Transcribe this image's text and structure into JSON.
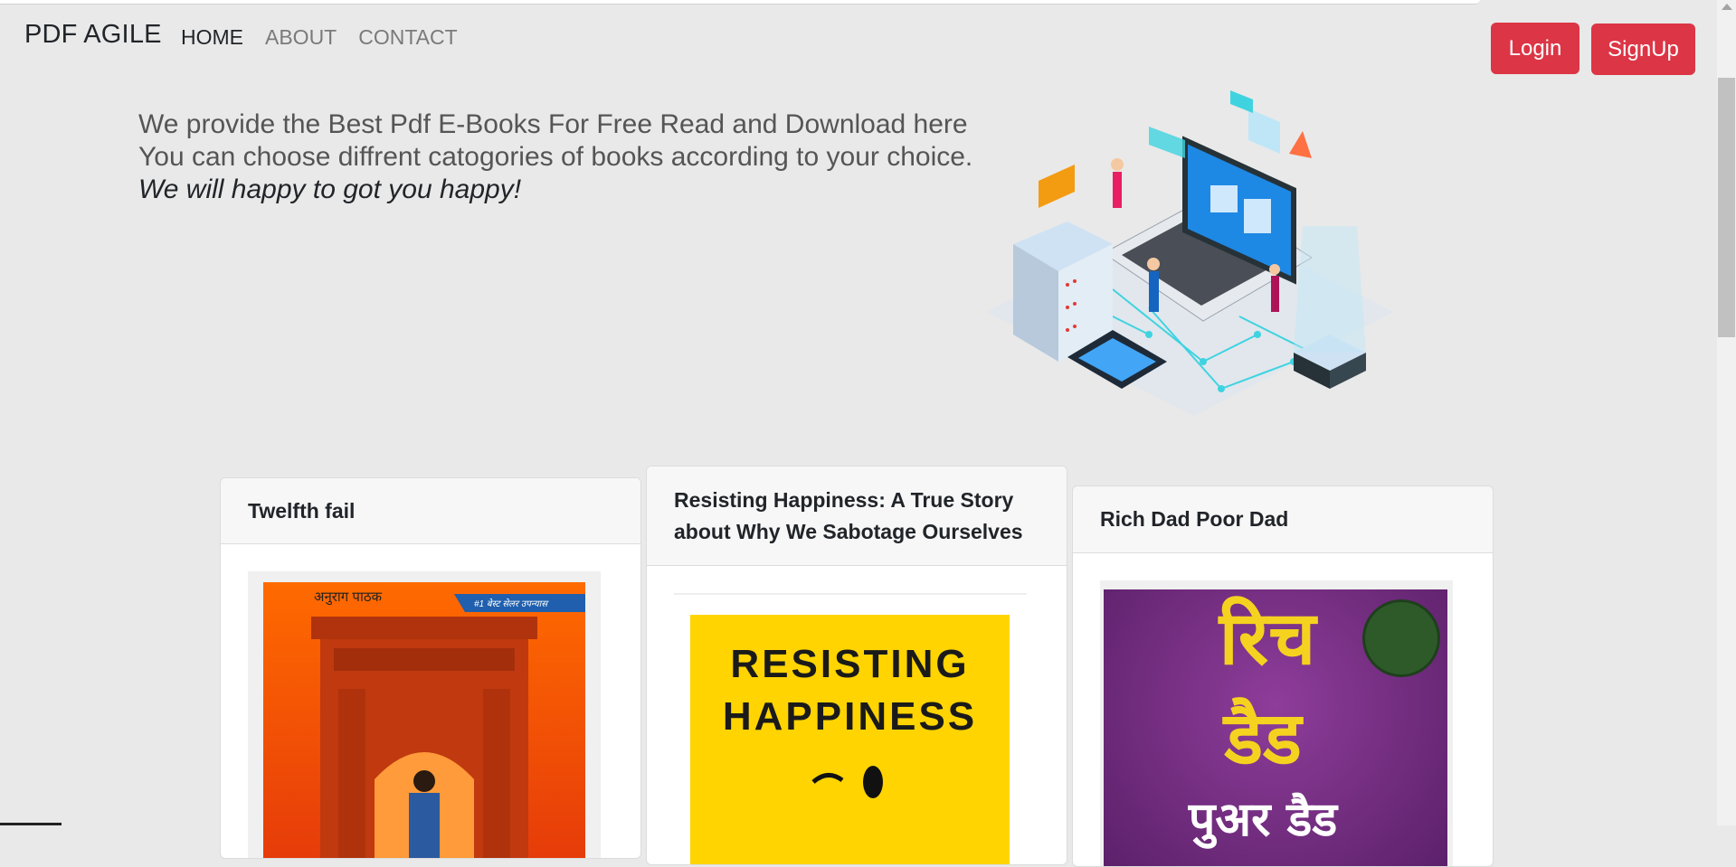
{
  "brand": "PDF AGILE",
  "nav": {
    "home": "HOME",
    "about": "ABOUT",
    "contact": "CONTACT"
  },
  "auth": {
    "login": "Login",
    "signup": "SignUp"
  },
  "hero": {
    "line1": "We provide the Best Pdf E-Books For Free Read and Download here",
    "line2": "You can choose diffrent catogories of books according to your choice.",
    "tagline": "We will happy to got you happy!"
  },
  "books": [
    {
      "title": "Twelfth fail",
      "cover": {
        "author": "अनुराग पाठक",
        "badge": "#1 बेस्ट सेलर उपन्यास"
      }
    },
    {
      "title": "Resisting Happiness: A True Story about Why We Sabotage Ourselves",
      "cover": {
        "line1": "RESISTING",
        "line2": "HAPPINESS"
      }
    },
    {
      "title": "Rich Dad Poor Dad",
      "cover": {
        "line1": "रिच",
        "line2": "डैड",
        "line3": "पुअर डैड"
      }
    }
  ],
  "colors": {
    "background": "#e9e9e9",
    "accent_red": "#dc3545",
    "card_header": "#f7f7f7"
  }
}
